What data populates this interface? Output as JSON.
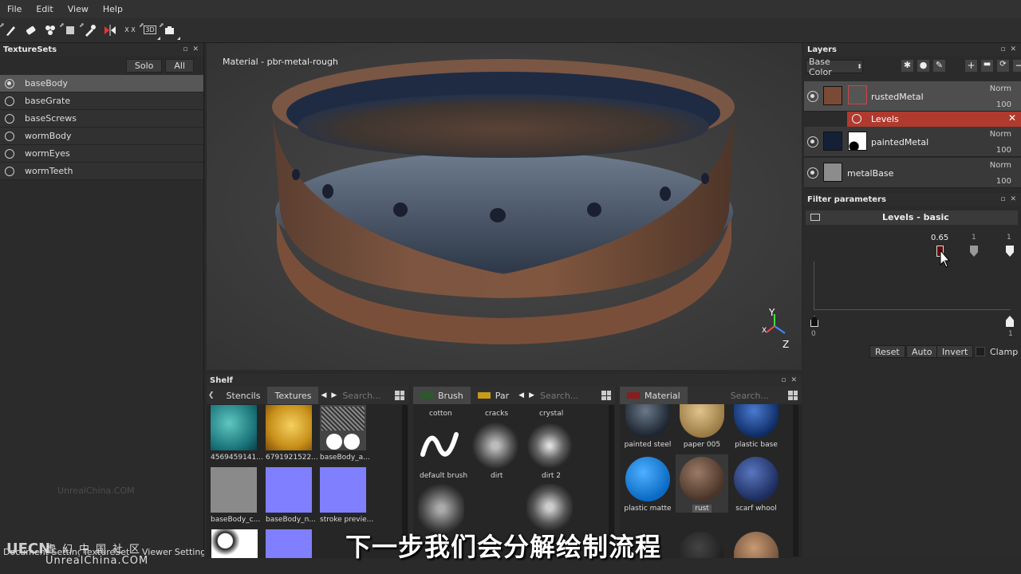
{
  "menu": [
    "File",
    "Edit",
    "View",
    "Help"
  ],
  "toolbar_icons": [
    "paint-brush-icon",
    "eraser-icon",
    "projection-icon",
    "polygon-fill-icon",
    "color-picker-icon",
    "symmetry-icon",
    "xyz-icon",
    "3d-toggle-icon",
    "camera-icon"
  ],
  "toolbar_xyz": "X X",
  "toolbar_3d": "3D",
  "texturesets": {
    "title": "TextureSets",
    "solo_label": "Solo",
    "all_label": "All",
    "items": [
      "baseBody",
      "baseGrate",
      "baseScrews",
      "wormBody",
      "wormEyes",
      "wormTeeth"
    ],
    "selected": "baseBody"
  },
  "viewport": {
    "material_label": "Material - pbr-metal-rough",
    "axis_y": "Y",
    "axis_x": "X",
    "axis_z": "Z"
  },
  "shelf": {
    "title": "Shelf",
    "tabs_left": [
      "Stencils",
      "Textures"
    ],
    "active_left": "Textures",
    "search_placeholder": "Search...",
    "textures": [
      {
        "label": "4569459141...",
        "color": "#1f7f86"
      },
      {
        "label": "6791921522...",
        "color": "#c8901a"
      },
      {
        "label": "baseBody_a...",
        "color": "#555555"
      },
      {
        "label": "baseBody_c...",
        "color": "#8a8a8a"
      },
      {
        "label": "baseBody_n...",
        "color": "#7f7fff"
      },
      {
        "label": "stroke previe...",
        "color": "#8080ff"
      }
    ],
    "brush_tab": "Brush",
    "particles_tab": "Par",
    "brush_search": "Search...",
    "brushes": [
      "cotton",
      "cracks",
      "crystal",
      "default brush",
      "dirt",
      "dirt 2"
    ],
    "material_tab": "Material",
    "material_search": "Search...",
    "materials": [
      {
        "label": "painted steel",
        "color": "#34404e"
      },
      {
        "label": "paper 005",
        "color": "#c4a26a"
      },
      {
        "label": "plastic base",
        "color": "#1f4e9a"
      },
      {
        "label": "plastic matte",
        "color": "#1a85e0"
      },
      {
        "label": "rust",
        "color": "#7a5a48"
      },
      {
        "label": "scarf whool",
        "color": "#3a56a0"
      }
    ]
  },
  "layers": {
    "title": "Layers",
    "channel": "Base Color",
    "rows": [
      {
        "name": "rustedMetal",
        "blend": "Norm",
        "opacity": "100",
        "swatch": "#7a4a36"
      },
      {
        "name": "paintedMetal",
        "blend": "Norm",
        "opacity": "100",
        "swatch": "#142036"
      },
      {
        "name": "metalBase",
        "blend": "Norm",
        "opacity": "100",
        "swatch": "#8c8c8c"
      }
    ],
    "effect": "Levels"
  },
  "filter": {
    "title": "Filter parameters",
    "header": "Levels - basic",
    "mid_value": "0.65",
    "right_value1": "1",
    "right_value2": "1",
    "min_label": "0",
    "max_label": "1",
    "reset_label": "Reset",
    "auto_label": "Auto",
    "invert_label": "Invert",
    "clamp_label": "Clamp"
  },
  "bottom_tabs": [
    "Document Setting",
    "TextureSet",
    "Viewer Setting"
  ],
  "subtitle": "下一步我们会分解绘制流程",
  "watermark": {
    "faint": "UnrealChina.COM",
    "logo": "UECN",
    "cn": "虚幻中国社区",
    "url": "UnrealChina.COM"
  },
  "colors": {
    "accent_red": "#b03a2e",
    "panel_bg": "#2b2b2b"
  }
}
